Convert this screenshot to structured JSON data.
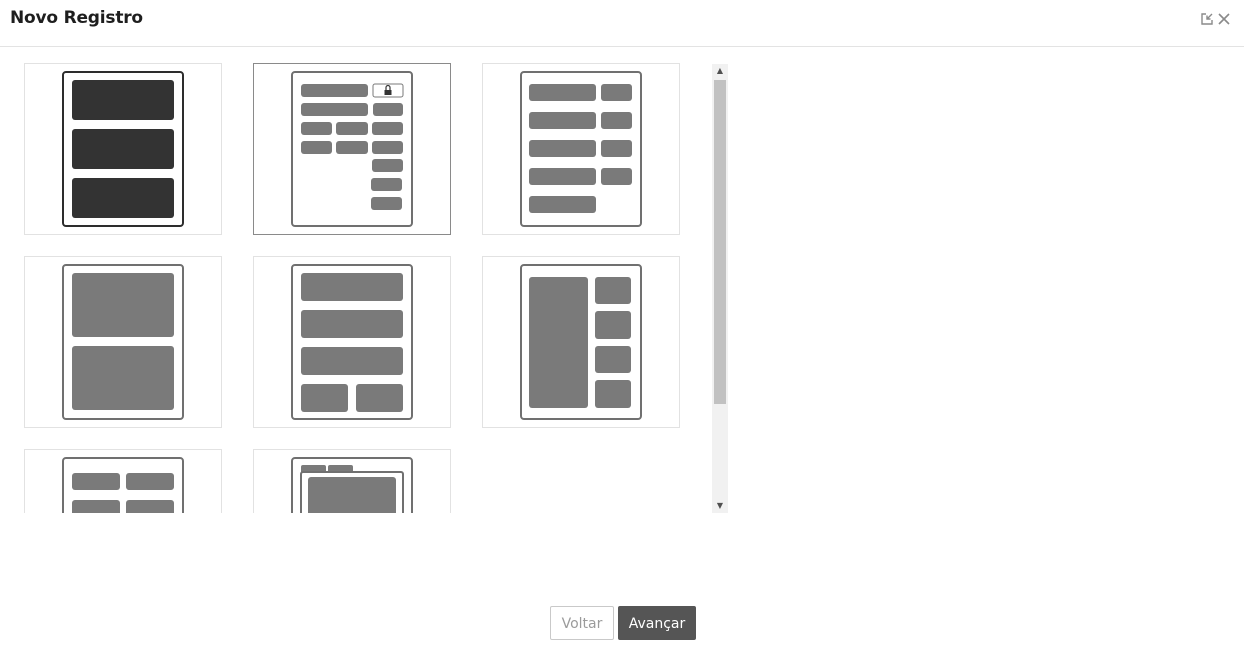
{
  "dialog": {
    "title": "Novo Registro"
  },
  "header_icons": [
    {
      "name": "minimize-window-icon"
    },
    {
      "name": "close-icon"
    }
  ],
  "layouts": [
    {
      "name": "three-stacked-blocks",
      "selected": false
    },
    {
      "name": "form-fields-with-lock",
      "selected": true
    },
    {
      "name": "two-column-fields",
      "selected": false
    },
    {
      "name": "two-large-blocks",
      "selected": false
    },
    {
      "name": "rows-with-split-footer",
      "selected": false
    },
    {
      "name": "sidebar-with-tiles",
      "selected": false
    },
    {
      "name": "grid-two-by-two",
      "selected": false
    },
    {
      "name": "tabs-with-panel",
      "selected": false
    }
  ],
  "colors": {
    "block_dark": "#333333",
    "block": "#7a7a7a",
    "frame": "#707070",
    "frame_dark": "#2d2d2d",
    "primary_button": "#555555",
    "card_border": "#e2e2e2",
    "card_selected_border": "#8a8a8a"
  },
  "footer": {
    "back_label": "Voltar",
    "next_label": "Avançar"
  }
}
